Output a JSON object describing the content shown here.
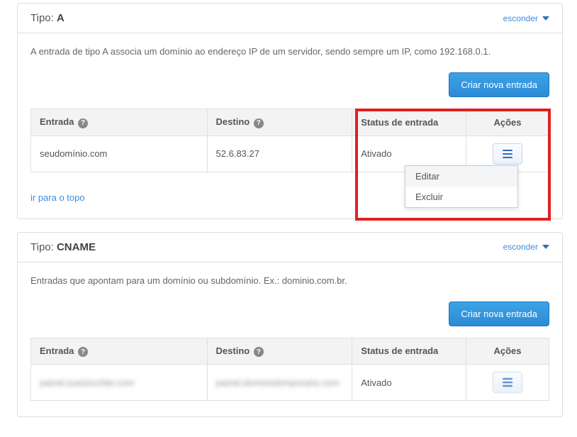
{
  "panels": {
    "a": {
      "type_label": "Tipo:",
      "type_value": "A",
      "hide_label": "esconder",
      "description": "A entrada de tipo A associa um domínio ao endereço IP de um servidor, sendo sempre um IP, como 192.168.0.1.",
      "create_button": "Criar nova entrada",
      "headers": {
        "entrada": "Entrada",
        "destino": "Destino",
        "status": "Status de entrada",
        "acoes": "Ações"
      },
      "row": {
        "entrada": "seudomínio.com",
        "destino": "52.6.83.27",
        "status": "Ativado"
      },
      "dropdown": {
        "editar": "Editar",
        "excluir": "Excluir"
      },
      "top_link": "ir para o topo"
    },
    "cname": {
      "type_label": "Tipo:",
      "type_value": "CNAME",
      "hide_label": "esconder",
      "description": "Entradas que apontam para um domínio ou subdomínio. Ex.: dominio.com.br.",
      "create_button": "Criar nova entrada",
      "headers": {
        "entrada": "Entrada",
        "destino": "Destino",
        "status": "Status de entrada",
        "acoes": "Ações"
      },
      "row": {
        "entrada": "painel.suelzischler.com",
        "destino": "painel.dominiotemporario.com",
        "status": "Ativado"
      }
    }
  }
}
